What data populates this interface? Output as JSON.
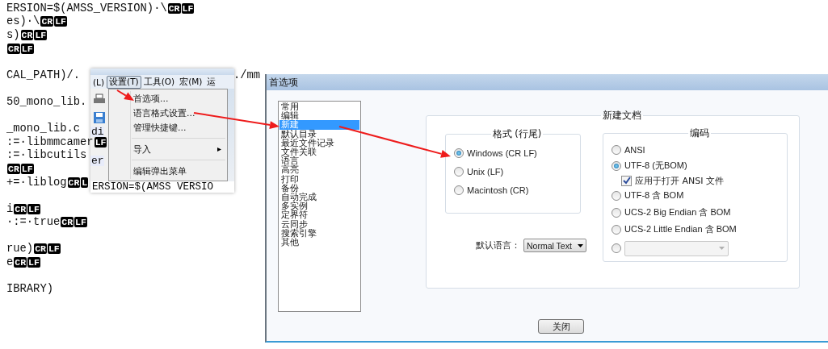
{
  "editor": {
    "blocks": [
      [
        {
          "text": "ERSION=$(AMSS_VERSION)·\\",
          "eol": [
            "CR",
            "LF"
          ]
        },
        {
          "text": "es)·\\",
          "eol": [
            "CR",
            "LF"
          ]
        },
        {
          "text": "s)",
          "eol": [
            "CR",
            "LF"
          ]
        },
        {
          "eol": [
            "CR",
            "LF"
          ]
        }
      ],
      [
        {
          "text": "CAL_PATH)/.",
          "tail": "./mm"
        }
      ],
      [
        {
          "text": "50_mono_lib."
        }
      ],
      [
        {
          "text": "_mono_lib.c"
        },
        {
          "text": ":=·libmmcamer",
          "eol": [
            "LF"
          ]
        },
        {
          "text": ":=·libcutils"
        },
        {
          "eol": [
            "CR",
            "LF"
          ]
        },
        {
          "text": "+=·liblog",
          "eol": [
            "CR",
            "L"
          ]
        }
      ],
      [
        {
          "text": "i",
          "eol": [
            "CR",
            "LF"
          ]
        },
        {
          "text": "·:=·true",
          "eol": [
            "CR",
            "LF"
          ]
        }
      ],
      [
        {
          "text": "rue)",
          "eol": [
            "CR",
            "LF"
          ]
        },
        {
          "text": "e",
          "eol": [
            "CR",
            "LF"
          ]
        }
      ],
      [
        {
          "text": "IBRARY)"
        }
      ]
    ]
  },
  "popup": {
    "menubar": [
      {
        "label": "(L)",
        "selected": false
      },
      {
        "label": "设置(T)",
        "selected": true
      },
      {
        "label": "工具(O)",
        "selected": false
      },
      {
        "label": "宏(M)",
        "selected": false
      },
      {
        "label": "运",
        "selected": false
      }
    ],
    "menu": [
      {
        "kind": "item",
        "label": "首选项..."
      },
      {
        "kind": "item",
        "label": "语言格式设置..."
      },
      {
        "kind": "item",
        "label": "管理快捷键..."
      },
      {
        "kind": "separator"
      },
      {
        "kind": "submenu",
        "label": "导入"
      },
      {
        "kind": "separator"
      },
      {
        "kind": "item",
        "label": "编辑弹出菜单"
      }
    ],
    "behind_lines": [
      "di",
      "er"
    ],
    "bottom_line": "ERSION=$(AMSS VERSIO"
  },
  "dialog": {
    "title": "首选项",
    "categories": [
      {
        "label": "常用",
        "selected": false
      },
      {
        "label": "编辑",
        "selected": false
      },
      {
        "label": "新建",
        "selected": true
      },
      {
        "label": "默认目录",
        "selected": false
      },
      {
        "label": "最近文件记录",
        "selected": false
      },
      {
        "label": "文件关联",
        "selected": false
      },
      {
        "label": "语言",
        "selected": false
      },
      {
        "label": "高亮",
        "selected": false
      },
      {
        "label": "打印",
        "selected": false
      },
      {
        "label": "备份",
        "selected": false
      },
      {
        "label": "自动完成",
        "selected": false
      },
      {
        "label": "多实例",
        "selected": false
      },
      {
        "label": "定界符",
        "selected": false
      },
      {
        "label": "云同步",
        "selected": false
      },
      {
        "label": "搜索引擎",
        "selected": false
      },
      {
        "label": "其他",
        "selected": false
      }
    ],
    "group_title": "新建文档",
    "line_endings": {
      "title": "格式 (行尾)",
      "options": [
        {
          "label": "Windows (CR LF)",
          "selected": true
        },
        {
          "label": "Unix (LF)",
          "selected": false
        },
        {
          "label": "Macintosh (CR)",
          "selected": false
        }
      ]
    },
    "default_language": {
      "label": "默认语言：",
      "value": "Normal Text"
    },
    "encoding": {
      "title": "编码",
      "options": [
        {
          "kind": "radio",
          "label": "ANSI",
          "selected": false
        },
        {
          "kind": "radio",
          "label": "UTF-8 (无BOM)",
          "selected": true,
          "sub_option": {
            "label": "应用于打开 ANSI 文件",
            "checked": true
          }
        },
        {
          "kind": "radio",
          "label": "UTF-8 含 BOM",
          "selected": false
        },
        {
          "kind": "radio",
          "label": "UCS-2 Big Endian 含 BOM",
          "selected": false
        },
        {
          "kind": "radio",
          "label": "UCS-2 Little Endian 含 BOM",
          "selected": false
        },
        {
          "kind": "combo",
          "selected": false,
          "disabled": true
        }
      ]
    },
    "close_button": "关闭"
  }
}
